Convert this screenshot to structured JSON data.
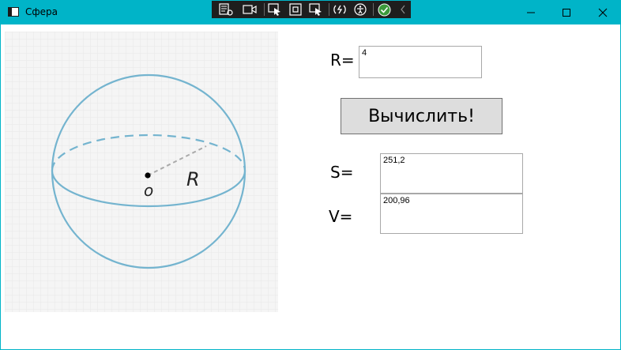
{
  "window": {
    "title": "Сфера",
    "accent": "#00b4c8"
  },
  "figure": {
    "center_label": "o",
    "radius_label": "R"
  },
  "form": {
    "r_label": "R=",
    "r_value": "4",
    "button_label": "Вычислить!",
    "s_label": "S=",
    "s_value": "251,2",
    "v_label": "V=",
    "v_value": "200,96"
  },
  "toolbar": {
    "icons": [
      "live-visual-tree-icon",
      "record-icon",
      "select-element-icon",
      "display-layout-adorners-icon",
      "track-focus-icon",
      "hot-reload-icon",
      "accessibility-icon",
      "binding-ok-icon",
      "collapse-toolbar-icon"
    ]
  }
}
